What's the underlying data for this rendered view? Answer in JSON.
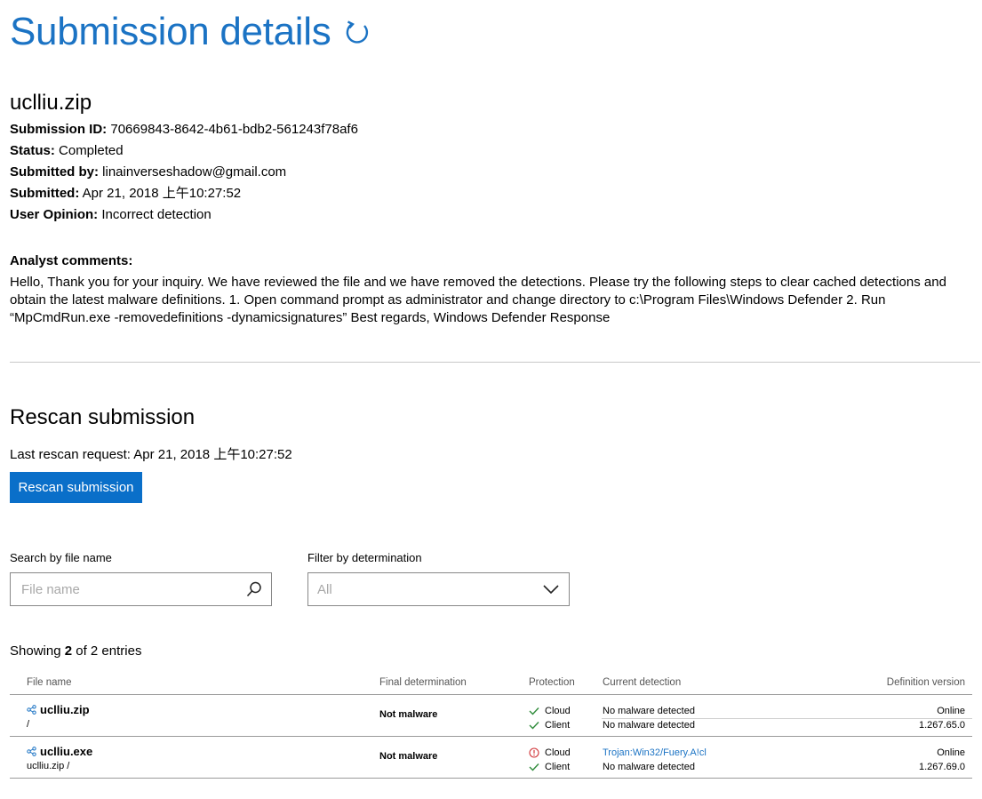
{
  "header": {
    "title": "Submission details",
    "refresh_icon": "refresh-icon"
  },
  "submission": {
    "file_name": "uclliu.zip",
    "fields": [
      {
        "label": "Submission ID:",
        "value": "70669843-8642-4b61-bdb2-561243f78af6"
      },
      {
        "label": "Status:",
        "value": "Completed"
      },
      {
        "label": "Submitted by:",
        "value": "linainverseshadow@gmail.com"
      },
      {
        "label": "Submitted:",
        "value": "Apr 21, 2018 上午10:27:52"
      },
      {
        "label": "User Opinion:",
        "value": "Incorrect detection"
      }
    ]
  },
  "analyst": {
    "label": "Analyst comments:",
    "text": "Hello, Thank you for your inquiry. We have reviewed the file and we have removed the detections. Please try the following steps to clear cached detections and obtain the latest malware definitions.   1. Open command prompt as administrator and change directory to c:\\Program Files\\Windows Defender 2. Run “MpCmdRun.exe -removedefinitions -dynamicsignatures” Best regards, Windows Defender Response"
  },
  "rescan": {
    "title": "Rescan submission",
    "last_request": "Last rescan request: Apr 21, 2018 上午10:27:52",
    "button": "Rescan submission"
  },
  "filters": {
    "search_label": "Search by file name",
    "search_placeholder": "File name",
    "filter_label": "Filter by determination",
    "filter_value": "All"
  },
  "showing": {
    "prefix": "Showing ",
    "count": "2",
    "suffix": " of 2 entries"
  },
  "table": {
    "columns": {
      "file_name": "File name",
      "final": "Final determination",
      "protection": "Protection",
      "current": "Current detection",
      "version": "Definition version"
    },
    "rows": [
      {
        "name": "uclliu.zip",
        "path": "/",
        "final": "Not malware",
        "prot1": "Cloud",
        "prot1_status": "ok",
        "prot2": "Client",
        "prot2_status": "ok",
        "det1": "No malware detected",
        "det2": "No malware detected",
        "ver1": "Online",
        "ver2": "1.267.65.0"
      },
      {
        "name": "uclliu.exe",
        "path": "uclliu.zip /",
        "final": "Not malware",
        "prot1": "Cloud",
        "prot1_status": "alert",
        "prot2": "Client",
        "prot2_status": "ok",
        "det1": "Trojan:Win32/Fuery.A!cl",
        "det2": "No malware detected",
        "ver1": "Online",
        "ver2": "1.267.69.0"
      }
    ]
  },
  "colors": {
    "accent": "#1b73c4",
    "button": "#0a6fc9",
    "ok": "#2e8b3a",
    "alert": "#d13438"
  }
}
